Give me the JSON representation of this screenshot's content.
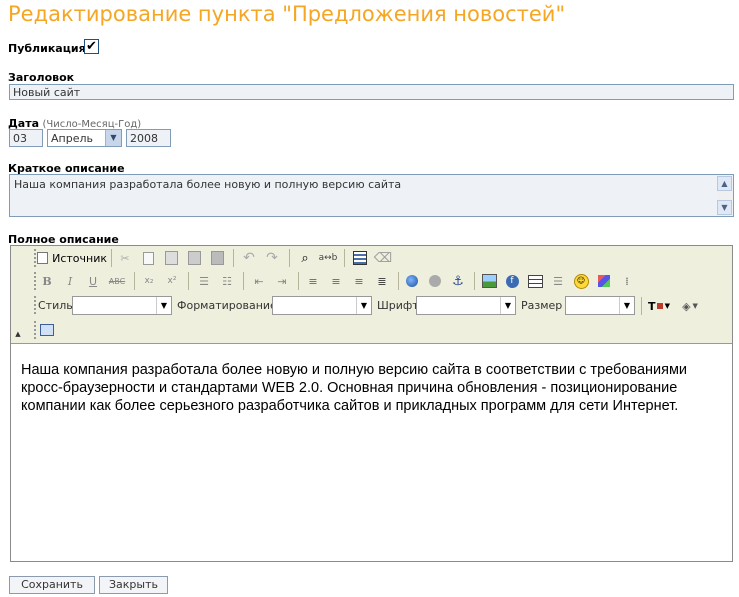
{
  "page": {
    "title": "Редактирование пункта \"Предложения новостей\""
  },
  "publish": {
    "label": "Публикация",
    "checked": true,
    "check_glyph": "✔"
  },
  "heading": {
    "label": "Заголовок",
    "value": "Новый сайт"
  },
  "date": {
    "label": "Дата",
    "hint": "(Число-Месяц-Год)",
    "day": "03",
    "month": "Апрель",
    "year": "2008"
  },
  "short_description": {
    "label": "Краткое описание",
    "value": "Наша компания разработала более новую и полную версию сайта"
  },
  "full_description": {
    "label": "Полное описание",
    "content": "Наша компания разработала более новую и полную версию сайта в соответствии с требованиями кросс-браузерности и стандартами WEB 2.0. Основная причина обновления - позиционирование компании как более серьезного разработчика сайтов и прикладных программ для сети Интернет."
  },
  "toolbar": {
    "source_label": "Источник",
    "bold": "B",
    "italic": "I",
    "underline": "U",
    "strike": "ABC",
    "style_label": "Стиль",
    "format_label": "Форматирование",
    "font_label": "Шрифт",
    "size_label": "Размер",
    "text_color": "T",
    "icons": {
      "cut": "cut-icon",
      "copy": "copy-icon",
      "paste": "paste-icon",
      "undo": "undo-icon",
      "redo": "redo-icon",
      "find": "find-icon",
      "smiley": "smiley-icon",
      "anchor": "anchor-icon"
    }
  },
  "buttons": {
    "save": "Сохранить",
    "close": "Закрыть"
  },
  "colors": {
    "title": "#F5A623",
    "field_bg": "#eef2f6",
    "field_border": "#7f9db9",
    "toolbar_bg": "#efefde"
  }
}
